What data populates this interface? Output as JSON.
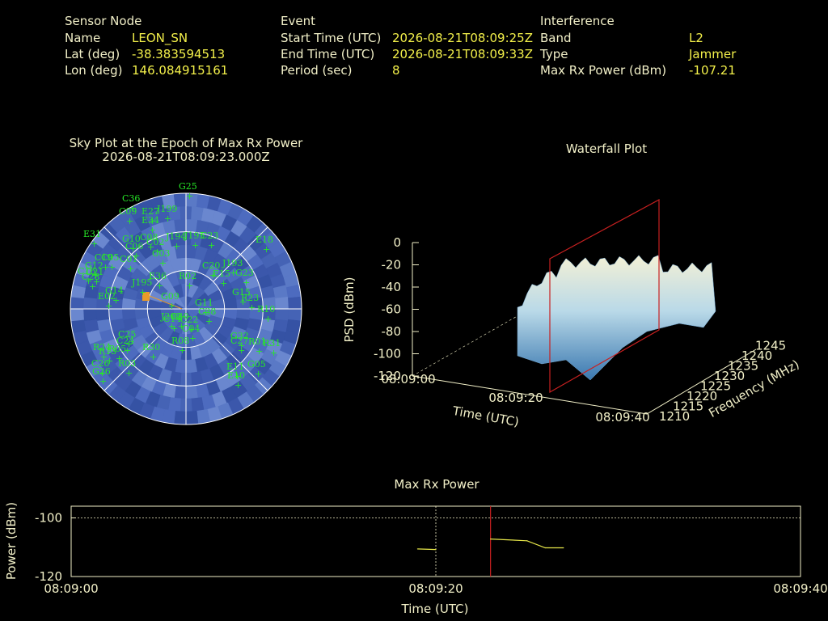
{
  "header": {
    "sensor": {
      "heading": "Sensor Node",
      "name_label": "Name",
      "name": "LEON_SN",
      "lat_label": "Lat (deg)",
      "lat": "-38.383594513",
      "lon_label": "Lon (deg)",
      "lon": "146.084915161"
    },
    "event": {
      "heading": "Event",
      "start_label": "Start Time (UTC)",
      "start": "2026-08-21T08:09:25Z",
      "end_label": "End Time (UTC)",
      "end": "2026-08-21T08:09:33Z",
      "period_label": "Period (sec)",
      "period": "8"
    },
    "interference": {
      "heading": "Interference",
      "band_label": "Band",
      "band": "L2",
      "type_label": "Type",
      "type": "Jammer",
      "max_label": "Max Rx Power (dBm)",
      "max": "-107.21"
    }
  },
  "sky": {
    "title": "Sky Plot at the Epoch of Max Rx Power",
    "subtitle": "2026-08-21T08:09:23.000Z",
    "satellites": [
      "G25",
      "C36",
      "C09",
      "E27",
      "J199",
      "E34",
      "E31",
      "E18",
      "G10",
      "C08",
      "C06",
      "C02",
      "J194",
      "J195",
      "C23",
      "C19",
      "C05",
      "C01",
      "C03",
      "G12",
      "C21",
      "C28",
      "C16",
      "C20",
      "J193",
      "E15",
      "G23",
      "E36",
      "R02",
      "G14",
      "J195",
      "G09",
      "E02",
      "G11",
      "C38",
      "J200",
      "C30",
      "G15",
      "R23",
      "R10",
      "C14",
      "C22",
      "C04",
      "C25",
      "C24",
      "R05",
      "R08",
      "G32",
      "C27",
      "R01",
      "R31",
      "R30",
      "R24",
      "R13",
      "C26",
      "R03",
      "G26",
      "E11",
      "G05",
      "E10"
    ]
  },
  "waterfall": {
    "title": "Waterfall Plot",
    "zlabel": "PSD (dBm)",
    "xlabel": "Time (UTC)",
    "ylabel": "Frequency (MHz)",
    "zticks": [
      "0",
      "-20",
      "-40",
      "-60",
      "-80",
      "-100",
      "-120"
    ],
    "xticks": [
      "08:09:00",
      "08:09:20",
      "08:09:40"
    ],
    "yticks": [
      "1210",
      "1215",
      "1220",
      "1225",
      "1230",
      "1235",
      "1240",
      "1245"
    ]
  },
  "chart_data": {
    "type": "line",
    "title": "Max Rx Power",
    "xlabel": "Time (UTC)",
    "ylabel": "Power (dBm)",
    "xticks": [
      "08:09:00",
      "08:09:20",
      "08:09:40"
    ],
    "yticks": [
      "-100",
      "-120"
    ],
    "xlim": [
      0,
      40
    ],
    "ylim": [
      -120,
      -96
    ],
    "grid": true,
    "series": [
      {
        "values": [
          {
            "x": 19.0,
            "y": -110.6
          },
          {
            "x": 20.0,
            "y": -110.8
          }
        ],
        "color": "#e8e84a"
      },
      {
        "values": [
          {
            "x": 23.0,
            "y": -107.2
          },
          {
            "x": 25.0,
            "y": -107.8
          },
          {
            "x": 26.0,
            "y": -110.2
          },
          {
            "x": 27.0,
            "y": -110.2
          }
        ],
        "color": "#e8e84a"
      }
    ],
    "event_marker_x": 23.0,
    "current_marker_x": 20.0
  }
}
